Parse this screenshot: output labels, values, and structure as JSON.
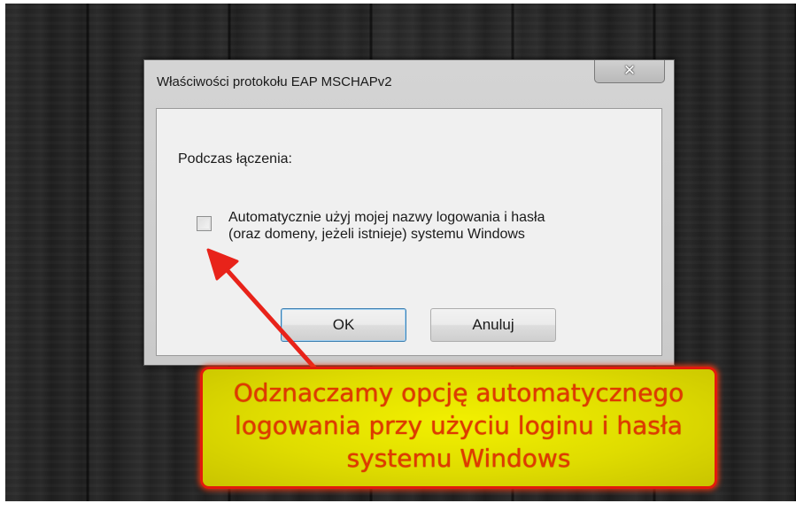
{
  "window": {
    "title": "Właściwości protokołu EAP MSCHAPv2",
    "close_glyph": "✕",
    "group_label": "Podczas łączenia:",
    "checkbox": {
      "checked": false,
      "label_line1": "Automatycznie użyj mojej nazwy logowania i hasła",
      "label_line2": "(oraz domeny, jeżeli istnieje) systemu Windows"
    },
    "ok_label": "OK",
    "cancel_label": "Anuluj"
  },
  "annotation": {
    "line1": "Odznaczamy opcję automatycznego",
    "line2": "logowania przy użyciu loginu i hasła",
    "line3": "systemu Windows",
    "text_color": "#e03a00",
    "box_color": "#e8e600",
    "border_color": "#e21a0c",
    "arrow_color": "#e8231a"
  }
}
